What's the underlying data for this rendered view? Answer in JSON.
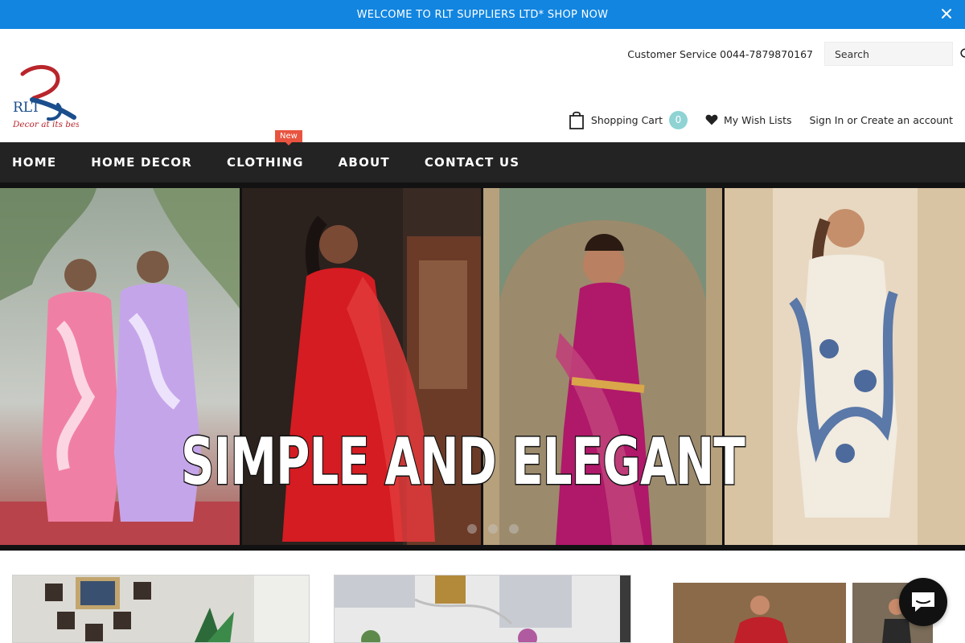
{
  "announcement": {
    "text": "WELCOME TO RLT SUPPLIERS LTD* SHOP NOW",
    "close_icon": "close-icon"
  },
  "logo": {
    "wordmark": "RLT",
    "tagline": "Decor at its best"
  },
  "header": {
    "customer_service": "Customer Service 0044-7879870167",
    "search_placeholder": "Search",
    "cart_label": "Shopping Cart",
    "cart_count": "0",
    "wishlist_label": "My Wish Lists",
    "sign_in": "Sign In",
    "or": "or",
    "create_account": "Create an account"
  },
  "nav": {
    "items": [
      {
        "label": "HOME"
      },
      {
        "label": "HOME DECOR"
      },
      {
        "label": "CLOTHING",
        "badge": "New"
      },
      {
        "label": "ABOUT"
      },
      {
        "label": "CONTACT US"
      }
    ]
  },
  "hero": {
    "caption": "SIMPLE AND ELEGANT",
    "slides": 3,
    "active_slide": 1
  },
  "colors": {
    "announce": "#1185e0",
    "nav": "#232323",
    "badge": "#e8543f",
    "cart_badge": "#8fd3d4"
  }
}
